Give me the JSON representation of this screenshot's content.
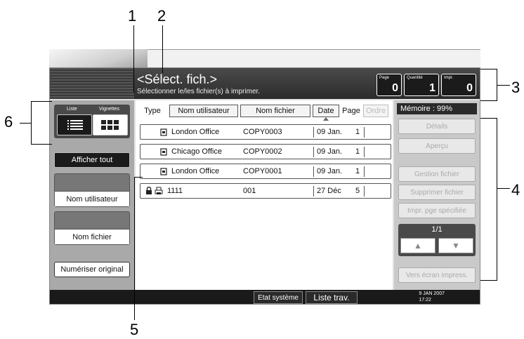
{
  "callouts": [
    "1",
    "2",
    "3",
    "4",
    "5",
    "6"
  ],
  "header": {
    "title": "<Sélect. fich.>",
    "subtitle": "Sélectionner le/les fichier(s) à imprimer.",
    "counters": [
      {
        "label": "Page",
        "value": "0"
      },
      {
        "label": "Quantité",
        "value": "1"
      },
      {
        "label": "Impr.",
        "value": "0"
      }
    ]
  },
  "view_toggle": {
    "list_label": "Liste",
    "thumb_label": "Vignettes",
    "selected": "Liste"
  },
  "left_panel": {
    "show_all": "Afficher tout",
    "user_name": "Nom utilisateur",
    "file_name": "Nom fichier",
    "scan_original": "Numériser original"
  },
  "columns": {
    "type": "Type",
    "user": "Nom utilisateur",
    "file": "Nom fichier",
    "date": "Date",
    "page": "Page",
    "order": "Ordre"
  },
  "rows": [
    {
      "user": "London Office",
      "file": "COPY0003",
      "date": "09 Jan.",
      "page": "1"
    },
    {
      "user": "Chicago Office",
      "file": "COPY0002",
      "date": "09 Jan.",
      "page": "1"
    },
    {
      "user": "London Office",
      "file": "COPY0001",
      "date": "09 Jan.",
      "page": "1"
    },
    {
      "user": "1111",
      "file": "001",
      "date": "27 Déc",
      "page": "5"
    }
  ],
  "right_panel": {
    "memory": "Mémoire :   99%",
    "details": "Détails",
    "preview": "Aperçu",
    "manage": "Gestion fichier",
    "delete": "Supprimer fichier",
    "print_page": "Impr. pge spécifiée",
    "page_indicator": "1/1",
    "to_print_screen": "Vers écran impress."
  },
  "footer": {
    "system_status": "Etat système",
    "job_list": "Liste trav.",
    "date": "9  JAN   2007",
    "time": "17:22"
  },
  "colors": {
    "header_bg": "#333333",
    "panel_bg": "#e2e2e2",
    "disabled_text": "#aaaaaa"
  }
}
